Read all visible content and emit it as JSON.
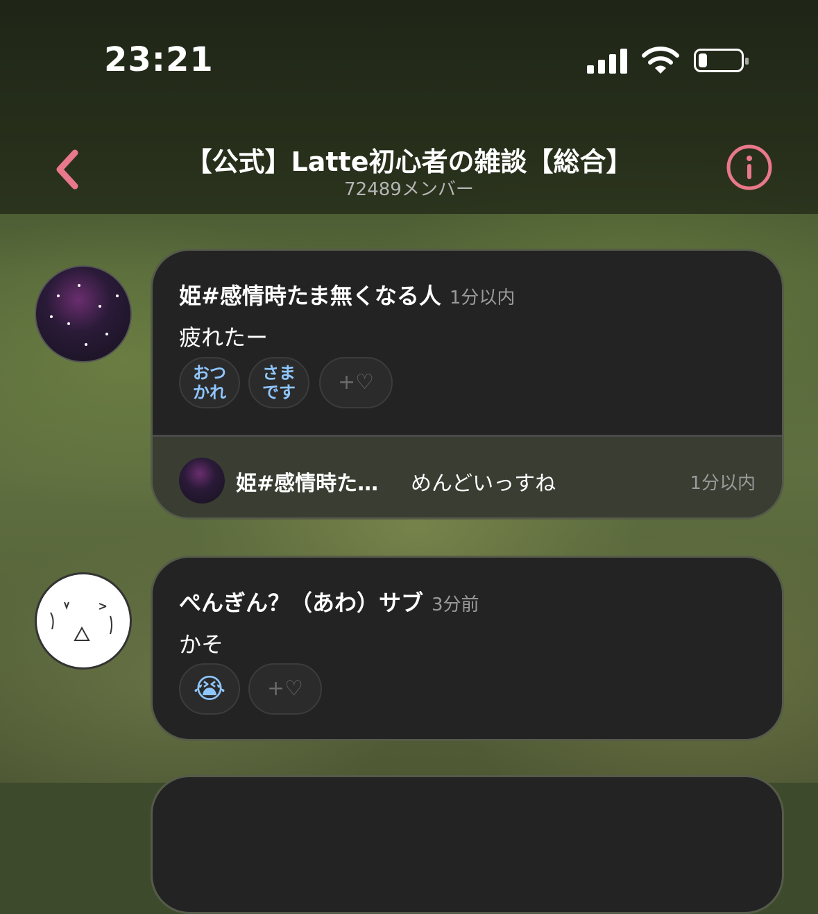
{
  "status_bar": {
    "time": "23:21",
    "icons": [
      "signal-icon",
      "wifi-icon",
      "battery-icon"
    ]
  },
  "header": {
    "title": "【公式】Latte初心者の雑談【総合】",
    "subtitle": "72489メンバー",
    "back_icon": "chevron-left-icon",
    "info_icon": "info-icon",
    "accent": "#e8788a"
  },
  "messages": [
    {
      "username": "姫#感情時たま無くなる人",
      "time": "1分以内",
      "text": "疲れたー",
      "reactions": [
        {
          "label_line1": "おつ",
          "label_line2": "かれ"
        },
        {
          "label_line1": "さま",
          "label_line2": "です"
        }
      ],
      "add_reaction": "+♡",
      "reply": {
        "username": "姫#感情時た…",
        "text": "めんどいっすね",
        "time": "1分以内"
      }
    },
    {
      "username": "ぺんぎん？（あわ）サブ",
      "time": "3分前",
      "text": "かそ",
      "reactions": [
        {
          "emoji": "😭"
        }
      ],
      "add_reaction": "+♡"
    }
  ],
  "colors": {
    "reaction_text": "#8fc6ff",
    "card_bg": "#232323"
  }
}
